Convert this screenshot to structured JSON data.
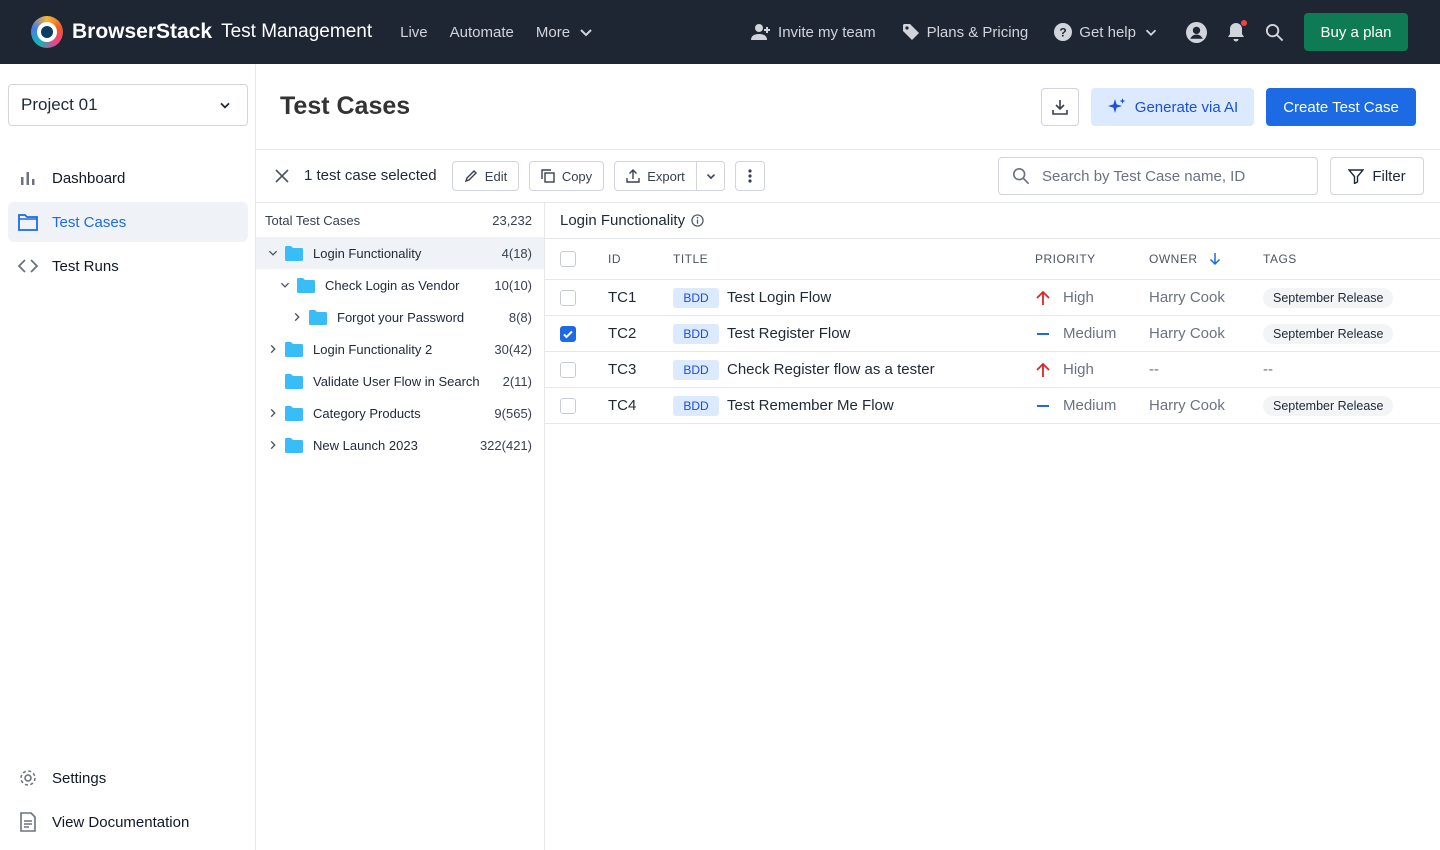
{
  "header": {
    "brand": "BrowserStack",
    "product": "Test Management",
    "nav": [
      "Live",
      "Automate",
      "More"
    ],
    "invite": "Invite my team",
    "plans": "Plans & Pricing",
    "help": "Get help",
    "buy": "Buy a plan"
  },
  "sidebar": {
    "project": "Project 01",
    "nav": [
      "Dashboard",
      "Test Cases",
      "Test Runs"
    ],
    "active": "Test Cases",
    "settings": "Settings",
    "docs": "View Documentation"
  },
  "page": {
    "title": "Test Cases",
    "generate": "Generate via AI",
    "create": "Create Test Case"
  },
  "toolbar": {
    "selected": "1 test case selected",
    "edit": "Edit",
    "copy": "Copy",
    "export": "Export",
    "search_placeholder": "Search by Test Case name, ID",
    "filter": "Filter"
  },
  "tree": {
    "total_label": "Total Test Cases",
    "total_count": "23,232",
    "items": [
      {
        "name": "Login Functionality",
        "count": "4(18)"
      },
      {
        "name": "Check Login as Vendor",
        "count": "10(10)"
      },
      {
        "name": "Forgot your Password",
        "count": "8(8)"
      },
      {
        "name": "Login Functionality 2",
        "count": "30(42)"
      },
      {
        "name": "Validate User Flow in Search",
        "count": "2(11)"
      },
      {
        "name": "Category Products",
        "count": "9(565)"
      },
      {
        "name": "New Launch 2023",
        "count": "322(421)"
      }
    ]
  },
  "detail": {
    "folder": "Login Functionality",
    "columns": [
      "ID",
      "TITLE",
      "PRIORITY",
      "OWNER",
      "TAGS"
    ],
    "rows": [
      {
        "id": "TC1",
        "type": "BDD",
        "title": "Test Login Flow",
        "priority": "High",
        "owner": "Harry Cook",
        "tag": "September Release",
        "checked": false
      },
      {
        "id": "TC2",
        "type": "BDD",
        "title": "Test Register Flow",
        "priority": "Medium",
        "owner": "Harry Cook",
        "tag": "September Release",
        "checked": true
      },
      {
        "id": "TC3",
        "type": "BDD",
        "title": "Check Register flow as a tester",
        "priority": "High",
        "owner": "--",
        "tag": "--",
        "checked": false
      },
      {
        "id": "TC4",
        "type": "BDD",
        "title": "Test Remember Me Flow",
        "priority": "Medium",
        "owner": "Harry Cook",
        "tag": "September Release",
        "checked": false
      }
    ]
  },
  "colors": {
    "topbar": "#1e2533",
    "primary": "#1d6ae5",
    "buy": "#0f7b55",
    "high": "#e02424",
    "medium": "#1d6ae5"
  }
}
